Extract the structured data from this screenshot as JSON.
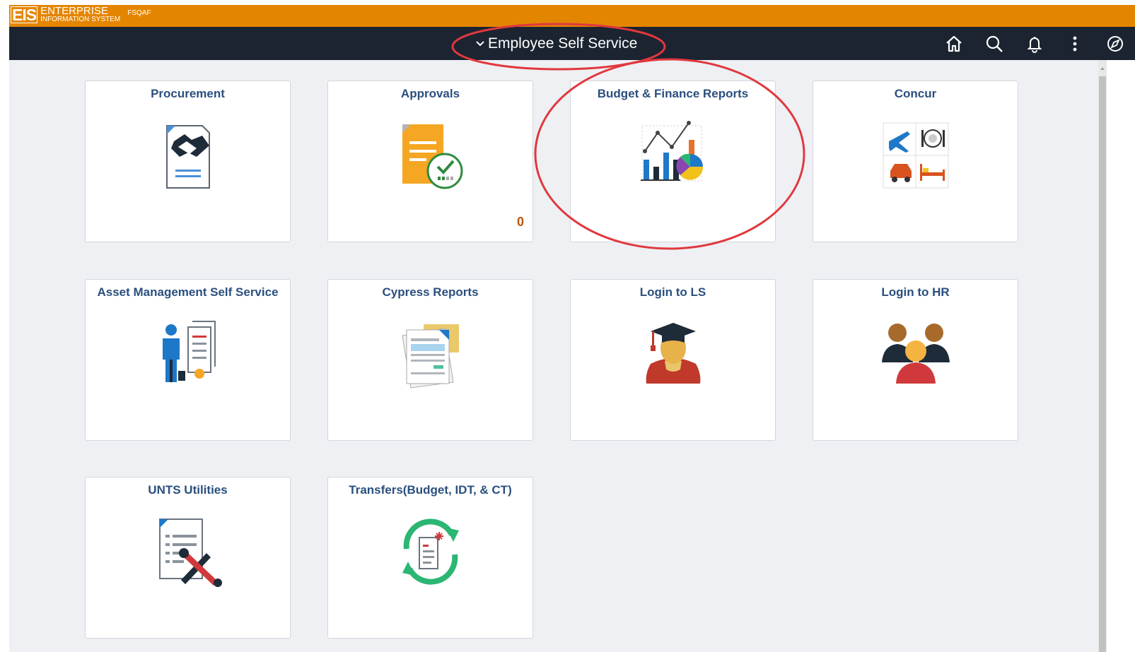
{
  "header": {
    "logo_mark": "EIS",
    "logo_line1": "ENTERPRISE",
    "logo_line2": "INFORMATION SYSTEM",
    "environment": "FSQAF",
    "brand_color": "#e48500"
  },
  "navbar": {
    "title": "Employee Self Service",
    "icons": [
      "home-icon",
      "search-icon",
      "bell-icon",
      "more-vertical-icon",
      "compass-icon"
    ],
    "background": "#1b2430"
  },
  "tiles": [
    {
      "title": "Procurement",
      "icon": "procurement-icon"
    },
    {
      "title": "Approvals",
      "icon": "approvals-icon",
      "badge": "0"
    },
    {
      "title": "Budget & Finance Reports",
      "icon": "reports-chart-icon"
    },
    {
      "title": "Concur",
      "icon": "concur-travel-icon"
    },
    {
      "title": "Asset Management Self Service",
      "icon": "asset-management-icon"
    },
    {
      "title": "Cypress Reports",
      "icon": "documents-icon"
    },
    {
      "title": "Login to LS",
      "icon": "graduate-icon"
    },
    {
      "title": "Login to HR",
      "icon": "people-icon"
    },
    {
      "title": "UNTS Utilities",
      "icon": "utilities-tools-icon"
    },
    {
      "title": "Transfers(Budget, IDT, & CT)",
      "icon": "transfer-cycle-icon"
    }
  ],
  "annotations": {
    "highlight_color": "#e0383e"
  }
}
